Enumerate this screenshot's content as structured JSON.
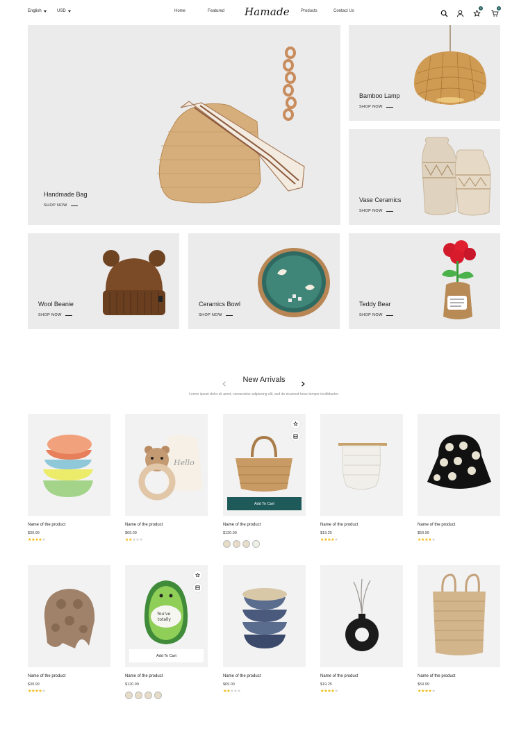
{
  "header": {
    "language": "English",
    "currency": "USD",
    "nav_left": [
      "Home",
      "Featured"
    ],
    "logo": "Hamade",
    "nav_right": [
      "Products",
      "Contact Us"
    ],
    "icons": [
      "search-icon",
      "user-icon",
      "wishlist-icon",
      "cart-icon"
    ],
    "wishlist_count": "0",
    "cart_count": "0"
  },
  "banners": [
    {
      "title": "Handmade Bag",
      "cta": "SHOP NOW"
    },
    {
      "title": "Bamboo Lamp",
      "cta": "SHOP NOW"
    },
    {
      "title": "Vase Ceramics",
      "cta": "SHOP NOW"
    },
    {
      "title": "Wool Beanie",
      "cta": "SHOP NOW"
    },
    {
      "title": "Ceramics Bowl",
      "cta": "SHOP NOW"
    },
    {
      "title": "Teddy Bear",
      "cta": "SHOP NOW"
    }
  ],
  "new_arrivals": {
    "title": "New Arrivals",
    "subtitle": "Lorem ipsum dolor sit amet, consectetur adipiscing elit, sed do eiusmod torus tempor incididunter.",
    "add_to_cart": "Add To Cart",
    "products": [
      {
        "name": "Name of the product",
        "price": "$39.99",
        "rating": 4
      },
      {
        "name": "Name of the product",
        "price": "$69.00",
        "rating": 2
      },
      {
        "name": "Name of the product",
        "price": "$120.99",
        "rating": 0,
        "hovered": true
      },
      {
        "name": "Name of the product",
        "price": "$19.25",
        "rating": 4
      },
      {
        "name": "Name of the product",
        "price": "$59.99",
        "rating": 4
      },
      {
        "name": "Name of the product",
        "price": "$39.99",
        "rating": 4
      },
      {
        "name": "Name of the product",
        "price": "$120.99",
        "rating": 0,
        "hovered": true
      },
      {
        "name": "Name of the product",
        "price": "$69.00",
        "rating": 2
      },
      {
        "name": "Name of the product",
        "price": "$19.25",
        "rating": 4
      },
      {
        "name": "Name of the product",
        "price": "$59.99",
        "rating": 4
      }
    ]
  },
  "colors": {
    "accent": "#1e5a5a",
    "star": "#f0b400",
    "tile_bg": "#ebebeb"
  }
}
